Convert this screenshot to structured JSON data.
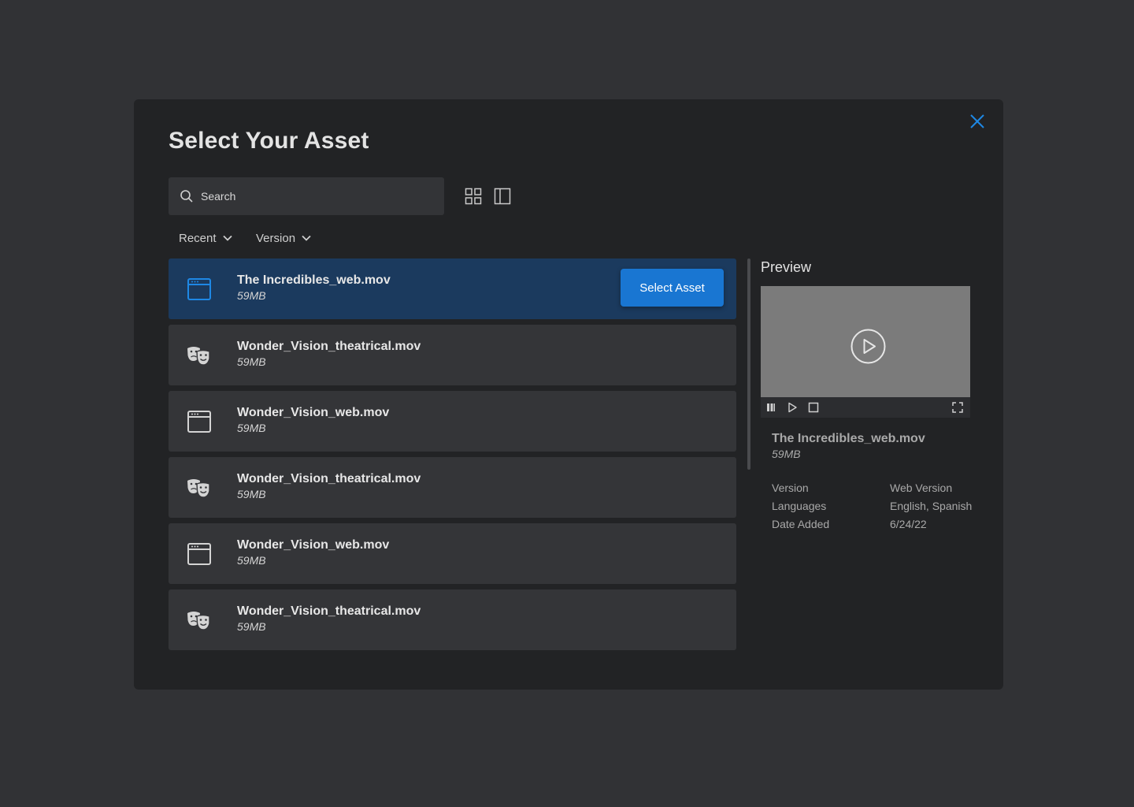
{
  "modal": {
    "title": "Select Your Asset"
  },
  "search": {
    "placeholder": "Search"
  },
  "filters": {
    "recent_label": "Recent",
    "version_label": "Version"
  },
  "assets": [
    {
      "name": "The Incredibles_web.mov",
      "size": "59MB",
      "icon": "browser-window-icon",
      "selected": true
    },
    {
      "name": "Wonder_Vision_theatrical.mov",
      "size": "59MB",
      "icon": "theater-masks-icon",
      "selected": false
    },
    {
      "name": "Wonder_Vision_web.mov",
      "size": "59MB",
      "icon": "browser-window-icon",
      "selected": false
    },
    {
      "name": "Wonder_Vision_theatrical.mov",
      "size": "59MB",
      "icon": "theater-masks-icon",
      "selected": false
    },
    {
      "name": "Wonder_Vision_web.mov",
      "size": "59MB",
      "icon": "browser-window-icon",
      "selected": false
    },
    {
      "name": "Wonder_Vision_theatrical.mov",
      "size": "59MB",
      "icon": "theater-masks-icon",
      "selected": false
    }
  ],
  "select_button_label": "Select Asset",
  "preview": {
    "title": "Preview",
    "file_name": "The Incredibles_web.mov",
    "file_size": "59MB",
    "meta": [
      {
        "key": "Version",
        "value": "Web Version"
      },
      {
        "key": "Languages",
        "value": "English, Spanish"
      },
      {
        "key": "Date Added",
        "value": "6/24/22"
      }
    ]
  },
  "colors": {
    "accent": "#1976d2",
    "selected_row": "#1b3a5e",
    "modal_bg": "#222325",
    "page_bg": "#313235"
  }
}
